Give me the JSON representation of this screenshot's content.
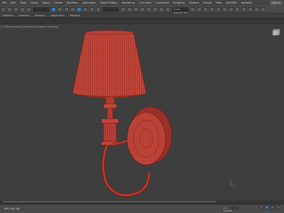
{
  "menu": {
    "items": [
      "File",
      "Edit",
      "Tools",
      "Group",
      "Views",
      "Create",
      "Modifiers",
      "Animation",
      "Graph Editors",
      "Rendering",
      "Civil View",
      "Customize",
      "Scripting",
      "Content",
      "Arnold",
      "Help",
      "3DSMAX",
      "tpaTools"
    ],
    "signin": "Sign In"
  },
  "toolbar": {
    "selection_set": "Create Selection Set"
  },
  "ribbon": {
    "tabs": [
      "Modeling",
      "Freeform",
      "Selection",
      "Object Paint",
      "Populate"
    ]
  },
  "viewport": {
    "label": "[+] [Perspective] [Standard] [Default Shading]"
  },
  "status": {
    "message": "Add Time Tag",
    "coord": "Grid = 10.0mm",
    "time": "0"
  },
  "colors": {
    "model_wire": "#b23a2e",
    "model_fill": "#c2463a",
    "viewport_bg": "#3e3e3e"
  }
}
